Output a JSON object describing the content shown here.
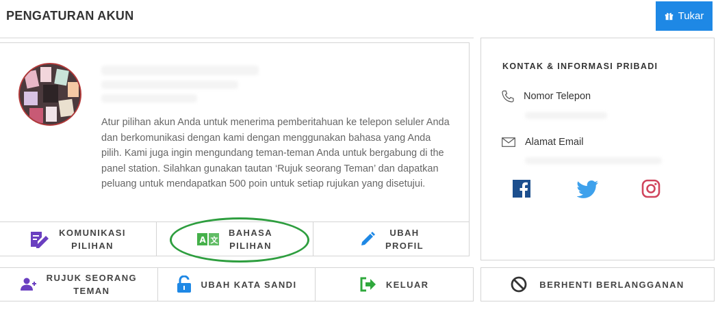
{
  "header": {
    "title": "PENGATURAN AKUN",
    "tukar_label": "Tukar"
  },
  "profile": {
    "description": "Atur pilihan akun Anda untuk menerima pemberitahuan ke telepon seluler Anda dan berkomunikasi dengan kami dengan menggunakan bahasa yang Anda pilih. Kami juga ingin mengundang teman-teman Anda untuk bergabung di the panel station. Silahkan gunakan tautan ‘Rujuk seorang Teman’ dan dapatkan peluang untuk mendapatkan 500 poin untuk setiap rujukan yang disetujui."
  },
  "actions": [
    {
      "label": "KOMUNIKASI\nPILIHAN",
      "icon": "edit-document-icon"
    },
    {
      "label": "BAHASA\nPILIHAN",
      "icon": "translate-icon"
    },
    {
      "label": "UBAH\nPROFIL",
      "icon": "pencil-icon"
    }
  ],
  "contact": {
    "title": "KONTAK & INFORMASI PRIBADI",
    "phone_label": "Nomor Telepon",
    "email_label": "Alamat Email"
  },
  "social": [
    "facebook-icon",
    "twitter-icon",
    "instagram-icon"
  ],
  "bottom_actions": [
    {
      "label": "RUJUK SEORANG\nTEMAN",
      "icon": "add-user-icon"
    },
    {
      "label": "UBAH KATA SANDI",
      "icon": "unlock-icon"
    },
    {
      "label": "KELUAR",
      "icon": "logout-icon"
    }
  ],
  "unsubscribe": {
    "label": "BERHENTI BERLANGGANAN",
    "icon": "block-icon"
  },
  "colors": {
    "accent": "#1e88e5",
    "highlight": "#2e9e3f",
    "purple": "#6a3fc0",
    "facebook": "#1c4f8e",
    "twitter": "#3ea1ec",
    "instagram": "#d0445c"
  }
}
